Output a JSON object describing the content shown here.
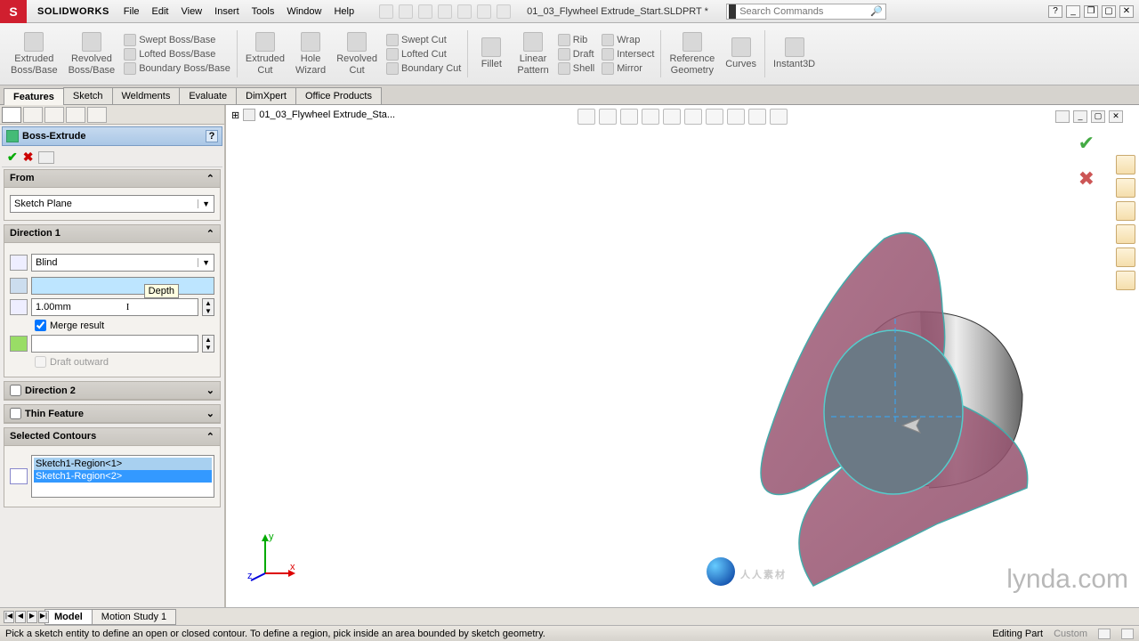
{
  "app": {
    "name": "SOLIDWORKS"
  },
  "menu": [
    "File",
    "Edit",
    "View",
    "Insert",
    "Tools",
    "Window",
    "Help"
  ],
  "doc": {
    "name": "01_03_Flywheel Extrude_Start.SLDPRT *",
    "short": "01_03_Flywheel Extrude_Sta..."
  },
  "search": {
    "placeholder": "Search Commands"
  },
  "ribbon": {
    "big": [
      {
        "l1": "Extruded",
        "l2": "Boss/Base"
      },
      {
        "l1": "Revolved",
        "l2": "Boss/Base"
      }
    ],
    "bossStack": [
      "Swept Boss/Base",
      "Lofted Boss/Base",
      "Boundary Boss/Base"
    ],
    "cut": [
      {
        "l1": "Extruded",
        "l2": "Cut"
      },
      {
        "l1": "Hole",
        "l2": "Wizard"
      },
      {
        "l1": "Revolved",
        "l2": "Cut"
      }
    ],
    "cutStack": [
      "Swept Cut",
      "Lofted Cut",
      "Boundary Cut"
    ],
    "pat": [
      {
        "l1": "Fillet",
        "l2": ""
      },
      {
        "l1": "Linear",
        "l2": "Pattern"
      }
    ],
    "patStack": [
      "Rib",
      "Draft",
      "Shell"
    ],
    "patStack2": [
      "Wrap",
      "Intersect",
      "Mirror"
    ],
    "ref": [
      {
        "l1": "Reference",
        "l2": "Geometry"
      },
      {
        "l1": "Curves",
        "l2": ""
      }
    ],
    "instant": {
      "l1": "Instant3D",
      "l2": ""
    }
  },
  "tabs": [
    "Features",
    "Sketch",
    "Weldments",
    "Evaluate",
    "DimXpert",
    "Office Products"
  ],
  "pm": {
    "title": "Boss-Extrude",
    "from": {
      "label": "From",
      "value": "Sketch Plane"
    },
    "dir1": {
      "label": "Direction 1",
      "type": "Blind",
      "depth": "1.00mm",
      "tooltip": "Depth",
      "merge": "Merge result",
      "draft": "Draft outward"
    },
    "dir2": {
      "label": "Direction 2"
    },
    "thin": {
      "label": "Thin Feature"
    },
    "contours": {
      "label": "Selected Contours",
      "items": [
        "Sketch1-Region<1>",
        "Sketch1-Region<2>"
      ]
    }
  },
  "vpToolCount": 12,
  "rightTools": 6,
  "btabs": [
    "Model",
    "Motion Study 1"
  ],
  "status": {
    "msg": "Pick a sketch entity to define an open or closed contour. To define a region, pick inside an area bounded by sketch geometry.",
    "mode": "Editing Part",
    "custom": "Custom"
  },
  "watermark1": "人人素材",
  "watermark2": "lynda.com"
}
